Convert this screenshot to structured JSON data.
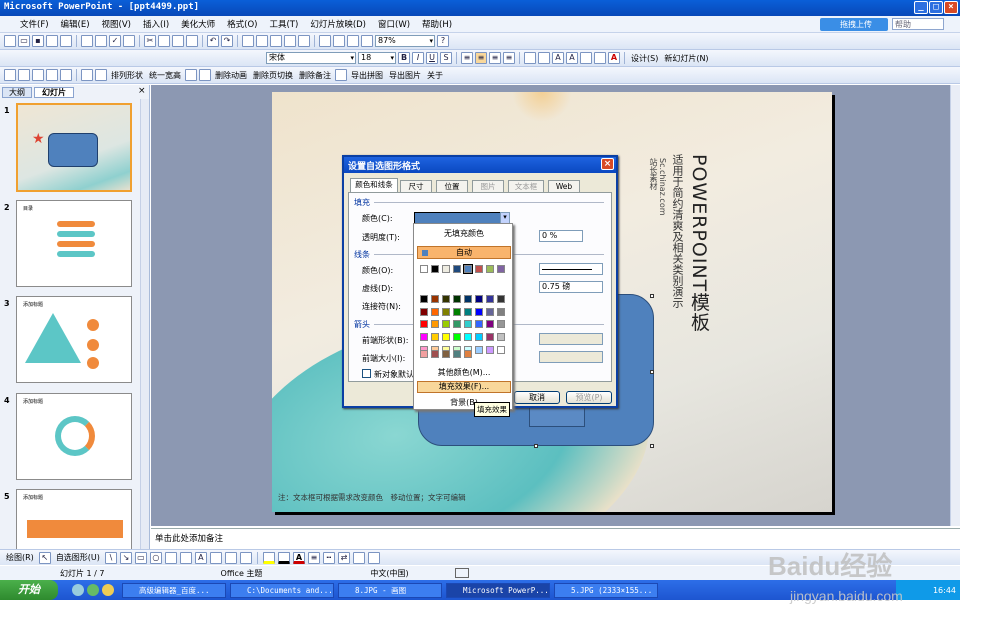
{
  "window": {
    "title": "Microsoft PowerPoint - [ppt4499.ppt]"
  },
  "menubar": {
    "items": [
      "文件(F)",
      "编辑(E)",
      "视图(V)",
      "插入(I)",
      "美化大师",
      "格式(O)",
      "工具(T)",
      "幻灯片放映(D)",
      "窗口(W)",
      "帮助(H)"
    ],
    "upload": "拖拽上传",
    "help_box": "帮助"
  },
  "toolbar1": {
    "zoom": "87%"
  },
  "toolbar2": {
    "font": "宋体",
    "size": "18",
    "design": "设计(S)",
    "new_slide": "新幻灯片(N)"
  },
  "toolbar3": {
    "items": [
      "排列形状",
      "统一宽高",
      "删除动画",
      "删除页切换",
      "删除备注",
      "导出拼图",
      "导出图片",
      "关于"
    ]
  },
  "leftpane": {
    "tabs": [
      "大纲",
      "幻灯片"
    ],
    "slides": [
      "1",
      "2",
      "3",
      "4",
      "5"
    ],
    "thumb_labels": [
      "",
      "目录",
      "添加标题",
      "添加标题",
      "添加标题"
    ]
  },
  "slide": {
    "title_en": "POWERPOINT模板",
    "subtitle": "适用于简约清爽及相关类别演示",
    "site": "Sc.chinaz.com",
    "brand": "站长素材",
    "footer": "注：文本框可根据需求改变颜色　移动位置；文字可编辑"
  },
  "dialog": {
    "title": "设置自选图形格式",
    "tabs": [
      "颜色和线条",
      "尺寸",
      "位置",
      "图片",
      "文本框",
      "Web"
    ],
    "sections": {
      "fill": "填充",
      "line": "线条",
      "arrow": "箭头"
    },
    "labels": {
      "color": "颜色(C):",
      "transparency": "透明度(T):",
      "line_color": "颜色(O):",
      "dash": "虚线(D):",
      "connector": "连接符(N):",
      "begin_style": "前端形状(B):",
      "begin_size": "前端大小(I):",
      "default": "新对象默认值(F)"
    },
    "values": {
      "transparency": "0 %",
      "weight": "0.75 磅"
    },
    "buttons": {
      "cancel": "取消",
      "preview": "预览(P)"
    }
  },
  "popup": {
    "no_fill": "无填充颜色",
    "auto": "自动",
    "more_colors": "其他颜色(M)...",
    "fill_effects": "填充效果(F)...",
    "background": "背景(B)",
    "tooltip": "填充效果"
  },
  "notes": {
    "placeholder": "单击此处添加备注"
  },
  "drawbar": {
    "draw": "绘图(R)",
    "autoshapes": "自选图形(U)"
  },
  "statusbar": {
    "slide": "幻灯片 1 / 7",
    "theme": "Office 主题",
    "lang": "中文(中国)"
  },
  "taskbar": {
    "start": "开始",
    "tasks": [
      "高级编辑器_百度...",
      "C:\\Documents and...",
      "8.JPG - 画图",
      "Microsoft PowerP...",
      "5.JPG (2333×155..."
    ],
    "clock": "16:44"
  },
  "watermark": {
    "brand": "Baidu经验",
    "url": "jingyan.baidu.com"
  },
  "colors": {
    "accent_blue": "#4f81bd",
    "highlight": "#f9b46c",
    "title_bar": "#0a48c0"
  }
}
